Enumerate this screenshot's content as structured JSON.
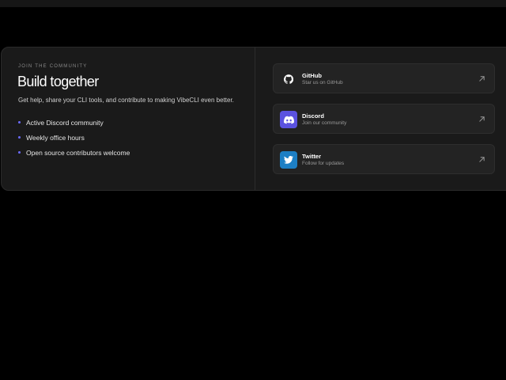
{
  "community": {
    "eyebrow": "JOIN THE COMMUNITY",
    "title": "Build together",
    "description": "Get help, share your CLI tools, and contribute to making VibeCLI even better.",
    "bullets": [
      "Active Discord community",
      "Weekly office hours",
      "Open source contributors welcome"
    ]
  },
  "links": [
    {
      "name": "GitHub",
      "subtitle": "Star us on GitHub",
      "icon": "github-icon",
      "icon_bg": "#232323"
    },
    {
      "name": "Discord",
      "subtitle": "Join our community",
      "icon": "discord-icon",
      "icon_bg": "#5b52e0"
    },
    {
      "name": "Twitter",
      "subtitle": "Follow for updates",
      "icon": "twitter-icon",
      "icon_bg": "#1d7fc4"
    }
  ],
  "colors": {
    "bullet_dot": "#6b6bff",
    "card_bg": "#1a1a1a"
  }
}
